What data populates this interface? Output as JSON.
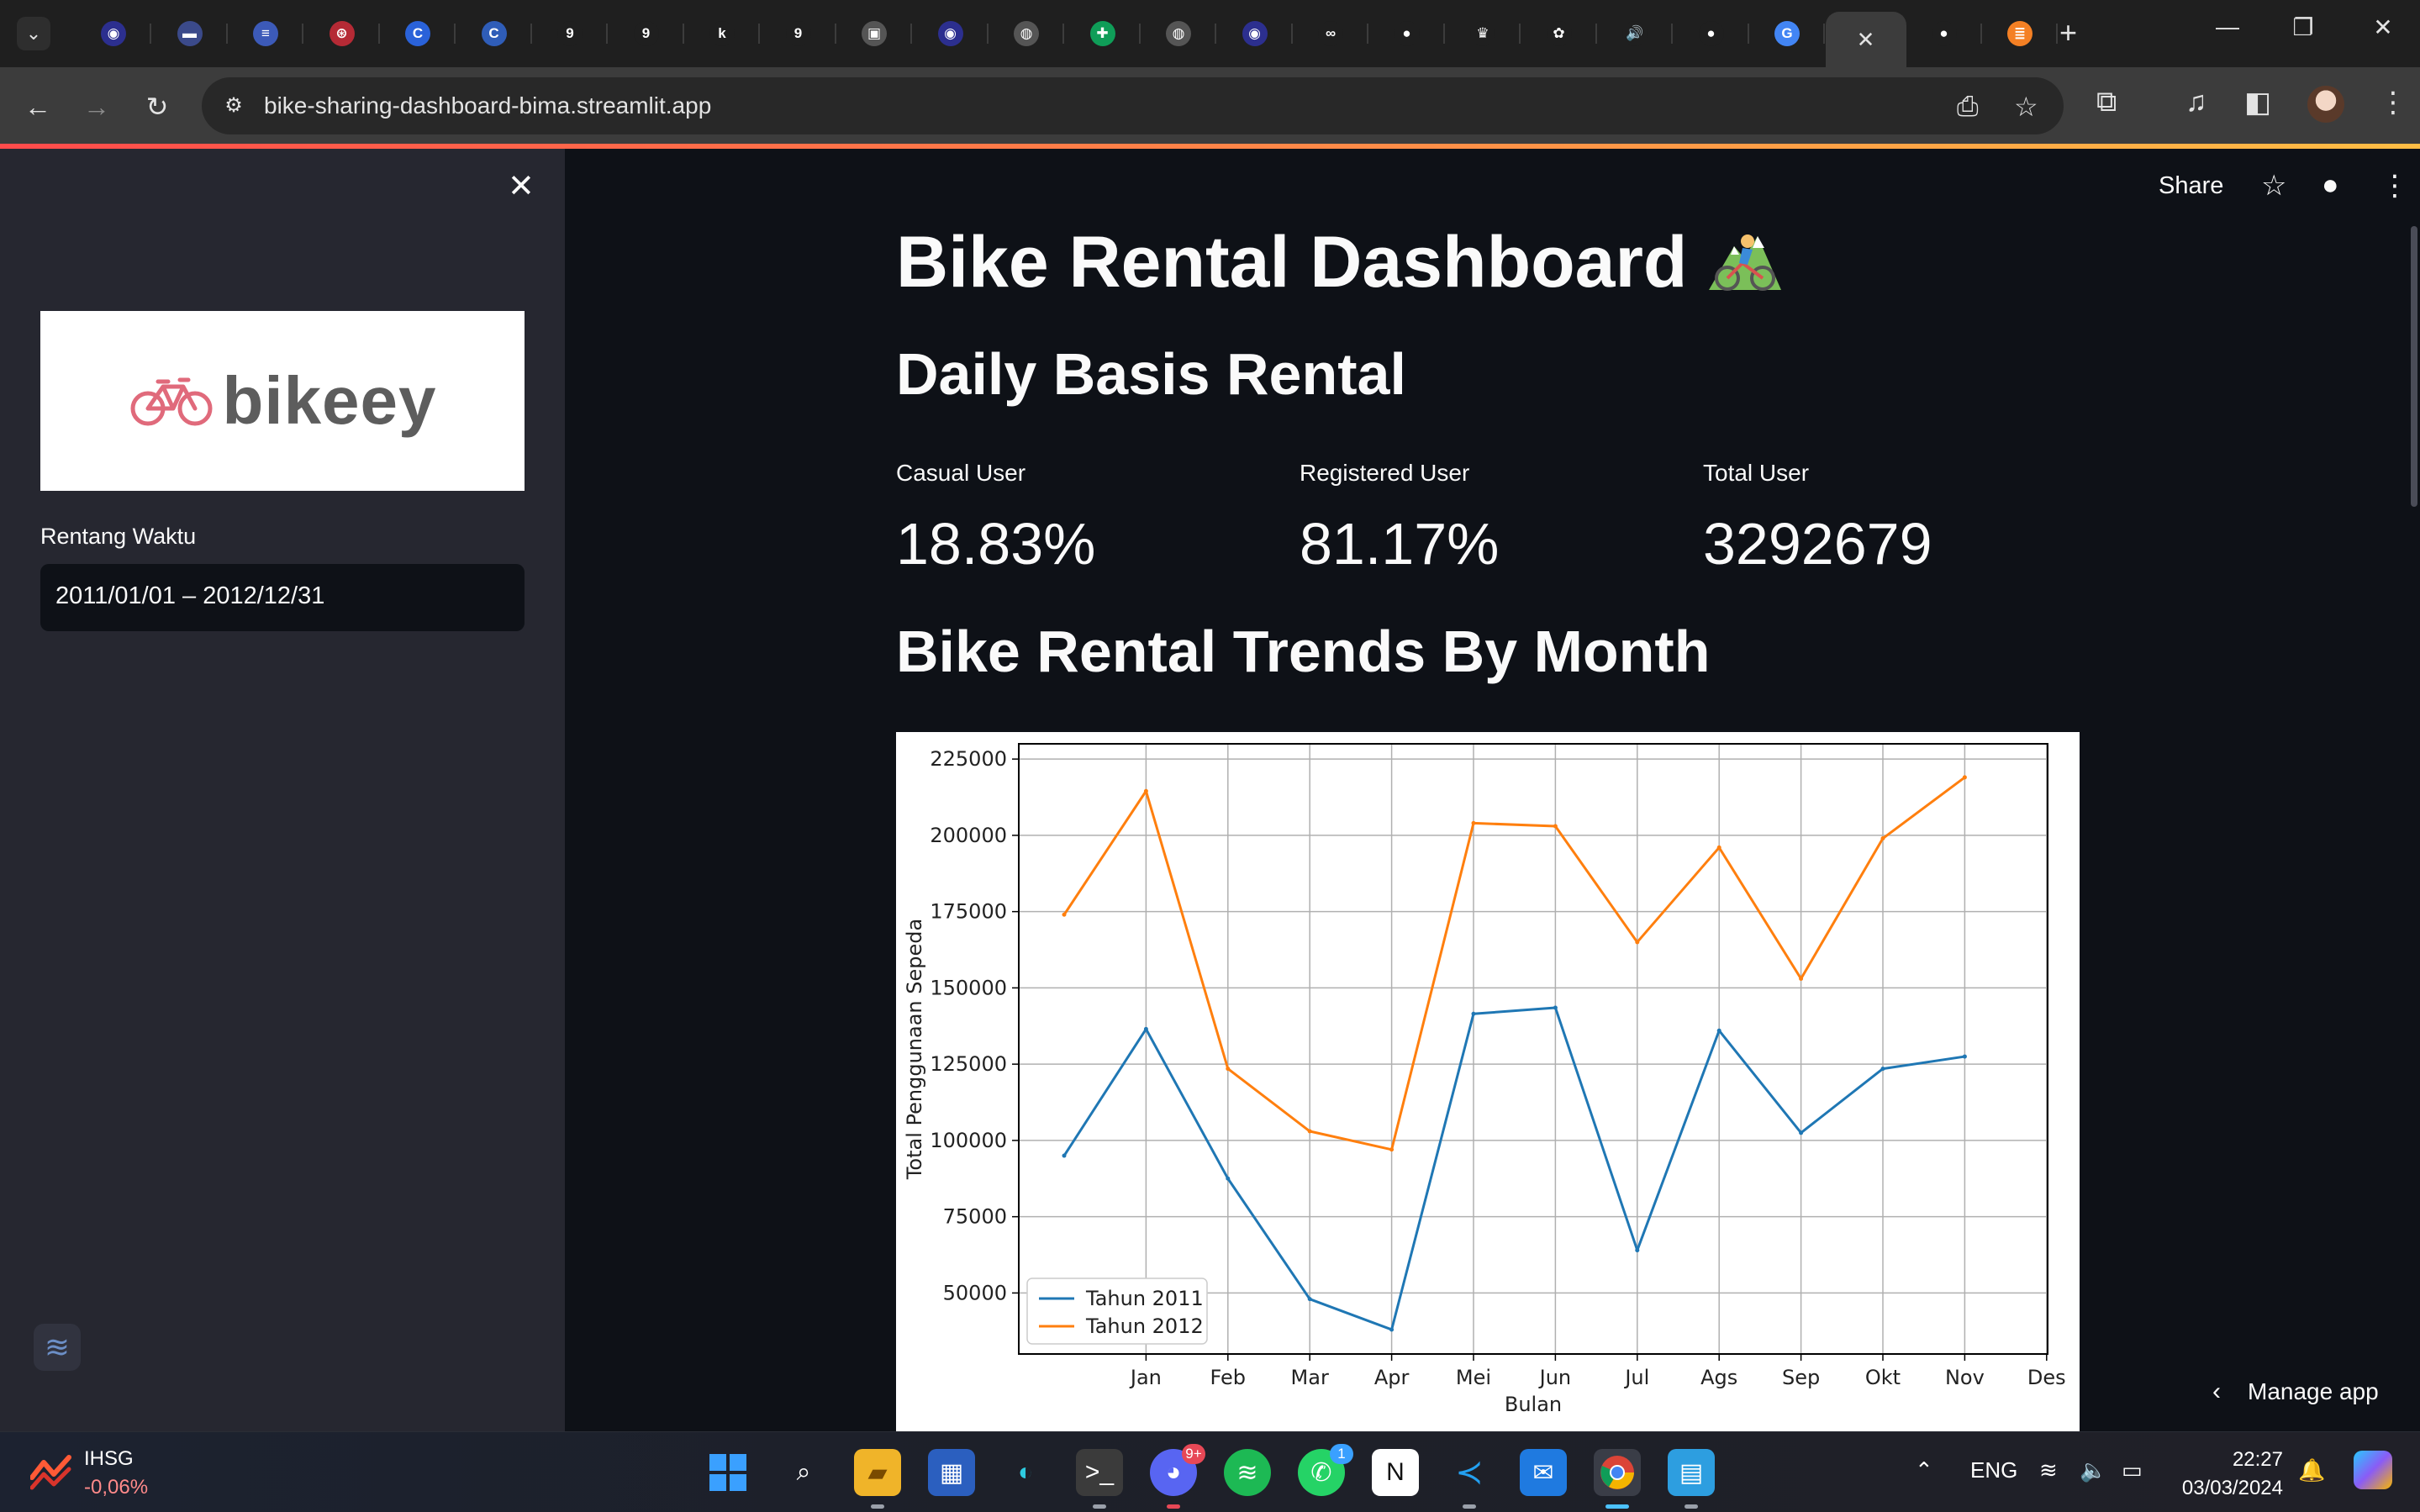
{
  "browser": {
    "active_tab_close": "✕",
    "new_tab": "+",
    "url": "bike-sharing-dashboard-bima.streamlit.app",
    "tab_favicons": [
      {
        "icon": "university-seal-icon",
        "glyph": "◉",
        "color": "#2c2f8f"
      },
      {
        "icon": "banner-icon",
        "glyph": "▬",
        "color": "#3b4a8a"
      },
      {
        "icon": "circle-stack-icon",
        "glyph": "≡",
        "color": "#3c5ab8"
      },
      {
        "icon": "chromatic-icon",
        "glyph": "⊛",
        "color": "#b52a35"
      },
      {
        "icon": "coursera-c-icon",
        "glyph": "C",
        "color": "#2a62d9"
      },
      {
        "icon": "c-circle-icon",
        "glyph": "C",
        "color": "#2f5db8"
      },
      {
        "icon": "g-icon",
        "glyph": "9",
        "color": "#1f1f1f"
      },
      {
        "icon": "g-icon",
        "glyph": "9",
        "color": "#1f1f1f"
      },
      {
        "icon": "k-icon",
        "glyph": "k",
        "color": "#1f1f1f"
      },
      {
        "icon": "g-icon",
        "glyph": "9",
        "color": "#1f1f1f"
      },
      {
        "icon": "contact-card-icon",
        "glyph": "▣",
        "color": "#555555"
      },
      {
        "icon": "university-seal-icon",
        "glyph": "◉",
        "color": "#2c2f8f"
      },
      {
        "icon": "globe-icon",
        "glyph": "◍",
        "color": "#555555"
      },
      {
        "icon": "google-sheets-icon",
        "glyph": "✚",
        "color": "#0f9d58"
      },
      {
        "icon": "globe-icon",
        "glyph": "◍",
        "color": "#555555"
      },
      {
        "icon": "university-seal-icon",
        "glyph": "◉",
        "color": "#2c2f8f"
      },
      {
        "icon": "infinity-icon",
        "glyph": "∞",
        "color": "#1f1f1f"
      },
      {
        "icon": "github-icon",
        "glyph": "●",
        "color": "#1f1f1f"
      },
      {
        "icon": "crown-icon",
        "glyph": "♛",
        "color": "#1f1f1f"
      },
      {
        "icon": "openai-icon",
        "glyph": "✿",
        "color": "#1f1f1f"
      },
      {
        "icon": "audio-playing-icon",
        "glyph": "🔊",
        "color": "#1f1f1f"
      },
      {
        "icon": "github-icon",
        "glyph": "●",
        "color": "#1f1f1f"
      },
      {
        "icon": "google-translate-icon",
        "glyph": "G",
        "color": "#4285f4"
      }
    ],
    "after_active_favicons": [
      {
        "icon": "github-icon",
        "glyph": "●",
        "color": "#1f1f1f"
      },
      {
        "icon": "stackoverflow-icon",
        "glyph": "≣",
        "color": "#f48024"
      }
    ]
  },
  "sidebar": {
    "logo_text": "bikeey",
    "date_label": "Rentang Waktu",
    "date_value": "2011/01/01 – 2012/12/31"
  },
  "header": {
    "share_label": "Share"
  },
  "main": {
    "title": "Bike Rental Dashboard",
    "daily_heading": "Daily Basis Rental",
    "metrics": [
      {
        "label": "Casual User",
        "value": "18.83%"
      },
      {
        "label": "Registered User",
        "value": "81.17%"
      },
      {
        "label": "Total User",
        "value": "3292679"
      }
    ],
    "trend_heading": "Bike Rental Trends By Month",
    "manage_app": "Manage app"
  },
  "chart_data": {
    "type": "line",
    "title": "",
    "xlabel": "Bulan",
    "ylabel": "Total Penggunaan Sepeda",
    "categories": [
      "Jan",
      "Feb",
      "Mar",
      "Apr",
      "Mei",
      "Jun",
      "Jul",
      "Ags",
      "Sep",
      "Okt",
      "Nov",
      "Des"
    ],
    "ylim": [
      30000,
      230000
    ],
    "yticks": [
      50000,
      75000,
      100000,
      125000,
      150000,
      175000,
      200000,
      225000
    ],
    "grid": true,
    "legend_position": "lower-left",
    "series": [
      {
        "name": "Tahun 2011",
        "color": "#1f77b4",
        "values": [
          95000,
          136500,
          87500,
          48000,
          38000,
          141500,
          143500,
          64000,
          136000,
          102500,
          123500,
          127500
        ]
      },
      {
        "name": "Tahun 2012",
        "color": "#ff7f0e",
        "values": [
          174000,
          214500,
          123500,
          103000,
          97000,
          204000,
          203000,
          165000,
          196000,
          153000,
          199000,
          219000
        ]
      }
    ]
  },
  "taskbar": {
    "stock_name": "IHSG",
    "stock_change": "-0,06%",
    "discord_badge": "9+",
    "whatsapp_badge": "1",
    "lang": "ENG",
    "time": "22:27",
    "date": "03/03/2024"
  },
  "colors": {
    "app_bg": "#0e1117",
    "sidebar_bg": "#262730",
    "text": "#fafafa",
    "series_2011": "#1f77b4",
    "series_2012": "#ff7f0e"
  }
}
